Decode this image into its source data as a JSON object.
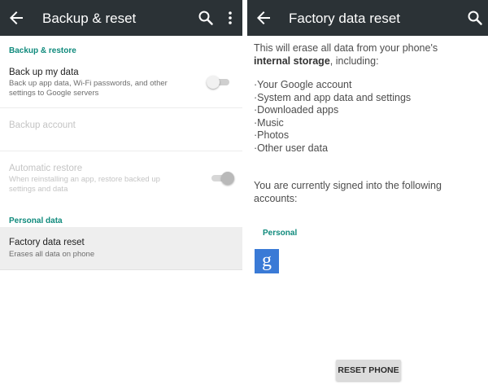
{
  "left": {
    "toolbar": {
      "title": "Backup & reset",
      "back_icon": "arrow-left-icon",
      "search_icon": "search-icon",
      "overflow_icon": "more-vert-icon"
    },
    "sections": [
      {
        "header": "Backup & restore"
      },
      {
        "header": "Personal data"
      }
    ],
    "items": [
      {
        "title": "Back up my data",
        "summary": "Back up app data, Wi-Fi passwords, and other settings to Google servers",
        "toggle": false,
        "enabled": true
      },
      {
        "title": "Backup account",
        "summary": "",
        "enabled": false
      },
      {
        "title": "Automatic restore",
        "summary": "When reinstalling an app, restore backed up settings and data",
        "toggle": true,
        "enabled": false
      },
      {
        "title": "Factory data reset",
        "summary": "Erases all data on phone",
        "enabled": true,
        "highlighted": true
      }
    ]
  },
  "right": {
    "toolbar": {
      "title": "Factory data reset",
      "back_icon": "arrow-left-icon",
      "search_icon": "search-icon"
    },
    "intro_plain": "This will erase all data from your phone's",
    "intro_bold": "internal storage",
    "intro_tail": ", including:",
    "bullets": [
      "·Your Google account",
      "·System and app data and settings",
      "·Downloaded apps",
      "·Music",
      "·Photos",
      "·Other user data"
    ],
    "signed_in_text": "You are currently signed into the following accounts:",
    "account_label": "Personal",
    "account_icon": "google-icon",
    "account_letter": "g",
    "reset_button": "RESET PHONE"
  },
  "colors": {
    "toolbar": "#2b3236",
    "accent": "#0f8a7c",
    "highlight_row": "#eeeeee",
    "google_blue": "#3a7ad6"
  }
}
